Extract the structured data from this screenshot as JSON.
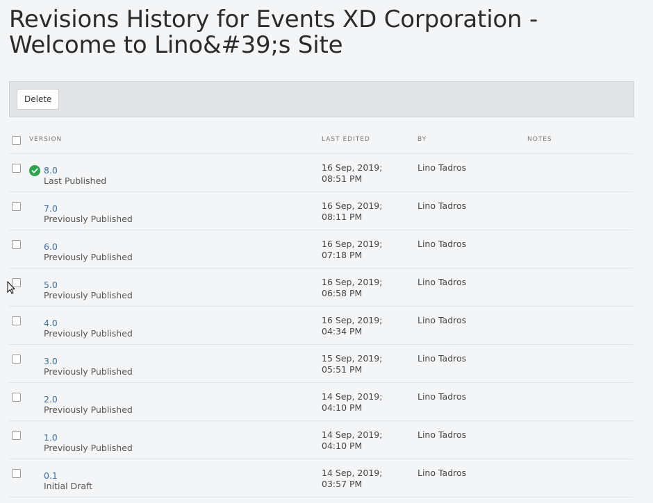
{
  "page": {
    "title": "Revisions History for Events XD Corporation - Welcome to Lino&#39;s Site"
  },
  "toolbar": {
    "delete_label": "Delete"
  },
  "table": {
    "headers": {
      "version": "VERSION",
      "last_edited": "LAST EDITED",
      "by": "BY",
      "notes": "NOTES"
    },
    "rows": [
      {
        "version": "8.0",
        "status": "Last Published",
        "date": "16 Sep, 2019; 08:51 PM",
        "by": "Lino Tadros",
        "notes": "",
        "published_icon": "check-circle-icon"
      },
      {
        "version": "7.0",
        "status": "Previously Published",
        "date": "16 Sep, 2019; 08:11 PM",
        "by": "Lino Tadros",
        "notes": ""
      },
      {
        "version": "6.0",
        "status": "Previously Published",
        "date": "16 Sep, 2019; 07:18 PM",
        "by": "Lino Tadros",
        "notes": ""
      },
      {
        "version": "5.0",
        "status": "Previously Published",
        "date": "16 Sep, 2019; 06:58 PM",
        "by": "Lino Tadros",
        "notes": ""
      },
      {
        "version": "4.0",
        "status": "Previously Published",
        "date": "16 Sep, 2019; 04:34 PM",
        "by": "Lino Tadros",
        "notes": ""
      },
      {
        "version": "3.0",
        "status": "Previously Published",
        "date": "15 Sep, 2019; 05:51 PM",
        "by": "Lino Tadros",
        "notes": ""
      },
      {
        "version": "2.0",
        "status": "Previously Published",
        "date": "14 Sep, 2019; 04:10 PM",
        "by": "Lino Tadros",
        "notes": ""
      },
      {
        "version": "1.0",
        "status": "Previously Published",
        "date": "14 Sep, 2019; 04:10 PM",
        "by": "Lino Tadros",
        "notes": ""
      },
      {
        "version": "0.1",
        "status": "Initial Draft",
        "date": "14 Sep, 2019; 03:57 PM",
        "by": "Lino Tadros",
        "notes": ""
      }
    ]
  },
  "colors": {
    "background": "#f4f5f7",
    "link": "#3a6ea5",
    "published_check": "#2ea44f",
    "toolbar_bg": "#e2e4e8"
  }
}
